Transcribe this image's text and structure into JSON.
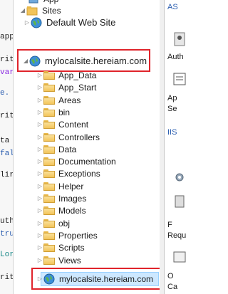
{
  "code_strip": {
    "fragments": [
      {
        "text": "app",
        "color": "#1b1b1b"
      },
      {
        "text": "rit",
        "color": "#1b1b1b"
      },
      {
        "text": "var",
        "color": "#8a2be2"
      },
      {
        "text": "e.",
        "color": "#2a5db0"
      },
      {
        "text": "rit",
        "color": "#1b1b1b"
      },
      {
        "text": "ta",
        "color": "#1b1b1b"
      },
      {
        "text": "fal",
        "color": "#2a5db0"
      },
      {
        "text": "lir",
        "color": "#1b1b1b"
      },
      {
        "text": "uth",
        "color": "#1b1b1b"
      },
      {
        "text": "tru",
        "color": "#2a5db0"
      },
      {
        "text": "Lor",
        "color": "#1b8a8a"
      },
      {
        "text": "rit",
        "color": "#1b1b1b"
      }
    ]
  },
  "tree": {
    "top_partial": "App",
    "sites_label": "Sites",
    "default_site": "Default Web Site",
    "mysite": "mylocalsite.hereiam.com",
    "folders": [
      "App_Data",
      "App_Start",
      "Areas",
      "bin",
      "Content",
      "Controllers",
      "Data",
      "Documentation",
      "Exceptions",
      "Helper",
      "Images",
      "Models",
      "obj",
      "Properties",
      "Scripts",
      "Views"
    ],
    "nested_site": "mylocalsite.hereiam.com"
  },
  "right_panel": {
    "partial_1": "AS",
    "partial_2": "Auth",
    "partial_3": "Ap",
    "partial_4": "Se",
    "partial_5": "IIS",
    "partial_6": "F",
    "partial_7": "Requ",
    "partial_8": "O",
    "partial_9": "Ca"
  },
  "colors": {
    "highlight_border": "#e0242b",
    "selected_bg": "#cde8ff"
  }
}
